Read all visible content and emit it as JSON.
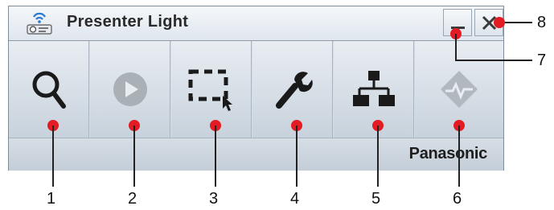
{
  "window": {
    "title": "Presenter Light",
    "minimize_icon": "minimize-icon",
    "close_icon": "close-icon"
  },
  "toolbar": {
    "buttons": [
      {
        "icon": "search-icon"
      },
      {
        "icon": "play-icon"
      },
      {
        "icon": "area-select-icon"
      },
      {
        "icon": "wrench-icon"
      },
      {
        "icon": "network-icon"
      },
      {
        "icon": "diamond-signal-icon"
      }
    ]
  },
  "statusbar": {
    "brand": "Panasonic"
  },
  "callouts": {
    "labels": [
      "1",
      "2",
      "3",
      "4",
      "5",
      "6",
      "7",
      "8"
    ],
    "dot_color": "#e31b23"
  }
}
